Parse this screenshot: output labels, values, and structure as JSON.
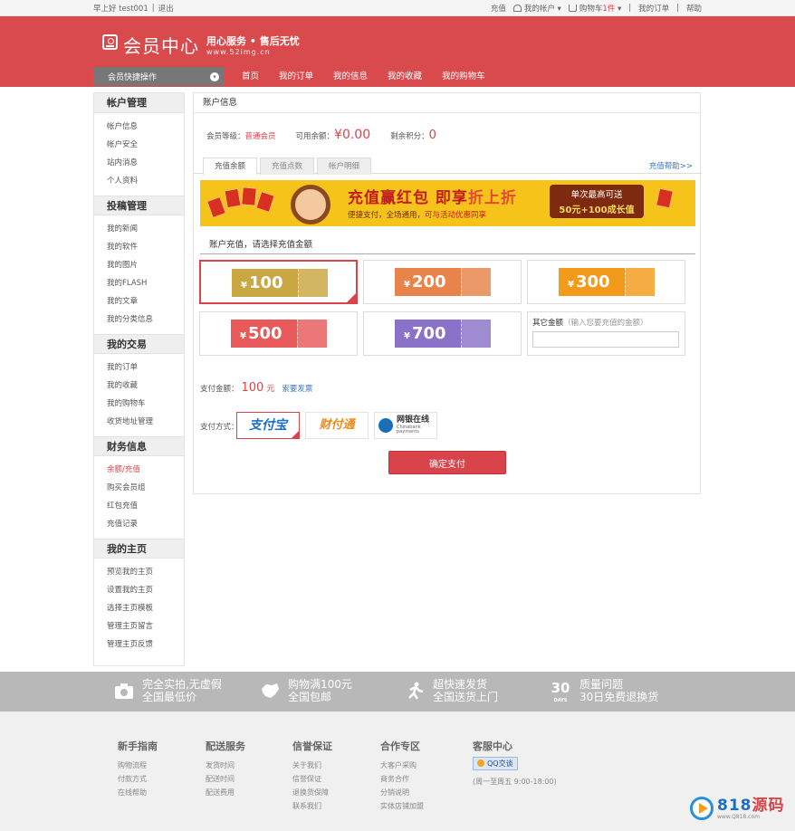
{
  "topbar": {
    "greeting": "早上好 test001",
    "logout": "退出",
    "recharge": "充值",
    "my_account": "我的帐户",
    "cart_label": "购物车",
    "cart_count": "1件",
    "my_orders": "我的订单",
    "help": "帮助"
  },
  "header": {
    "title": "会员中心",
    "slogan": "用心服务 • 售后无忧",
    "url": "www.52img.cn"
  },
  "nav": {
    "quick": "会员快捷操作",
    "links": [
      "首页",
      "我的订单",
      "我的信息",
      "我的收藏",
      "我的购物车"
    ]
  },
  "sidebar": [
    {
      "title": "帐户管理",
      "items": [
        "帐户信息",
        "帐户安全",
        "站内消息",
        "个人资料"
      ]
    },
    {
      "title": "投稿管理",
      "items": [
        "我的新闻",
        "我的软件",
        "我的图片",
        "我的FLASH",
        "我的文章",
        "我的分类信息"
      ]
    },
    {
      "title": "我的交易",
      "items": [
        "我的订单",
        "我的收藏",
        "我的购物车",
        "收货地址管理"
      ]
    },
    {
      "title": "财务信息",
      "items": [
        "余额/充值",
        "购买会员组",
        "红包充值",
        "充值记录"
      ]
    },
    {
      "title": "我的主页",
      "items": [
        "预览我的主页",
        "设置我的主页",
        "选择主页模板",
        "管理主页留言",
        "管理主页反馈"
      ]
    }
  ],
  "account": {
    "header": "账户信息",
    "level_label": "会员等级：",
    "level": "普通会员",
    "balance_label": "可用余额：",
    "balance": "¥0.00",
    "points_label": "剩余积分：",
    "points": "0"
  },
  "tabs": [
    "充值余额",
    "充值点数",
    "帐户明细"
  ],
  "recharge_help": "充值帮助>>",
  "banner": {
    "t1": "充值赢红包",
    "t2": "即享",
    "t3": "折上折",
    "sub1": "便捷支付，全场通用，",
    "sub2": "可与活动优惠同享",
    "box1": "单次最高可送",
    "box2": "50元+100成长值"
  },
  "select_title": "账户充值，请选择充值金额",
  "amounts": [
    "100",
    "200",
    "300",
    "500",
    "700"
  ],
  "currency": "¥",
  "other": {
    "label": "其它金额",
    "hint": "（输入您要充值的金额）",
    "value": ""
  },
  "pay": {
    "label": "支付金额：",
    "amount": "100",
    "unit": "元",
    "invoice": "索要发票"
  },
  "methods": {
    "label": "支付方式：",
    "alipay": "支付宝",
    "tenpay": "财付通",
    "chinabank": "网银在线",
    "chinabank_en": "Chinabank payments"
  },
  "submit": "确定支付",
  "promos": [
    {
      "l1": "完全实拍,无虚假",
      "l2": "全国最低价"
    },
    {
      "l1": "购物满100元",
      "l2": "全国包邮"
    },
    {
      "l1": "超快速发货",
      "l2": "全国送货上门"
    },
    {
      "l1": "质量问题",
      "l2": "30日免费退换货"
    }
  ],
  "days_badge": {
    "num": "30",
    "word": "DAYS"
  },
  "footer": {
    "cols": [
      {
        "title": "新手指南",
        "items": [
          "购物流程",
          "付款方式",
          "在线帮助"
        ]
      },
      {
        "title": "配送服务",
        "items": [
          "发货时间",
          "配送时间",
          "配送费用"
        ]
      },
      {
        "title": "信誉保证",
        "items": [
          "关于我们",
          "信誉保证",
          "退换货保障",
          "联系我们"
        ]
      },
      {
        "title": "合作专区",
        "items": [
          "大客户采购",
          "商务合作",
          "分销说明",
          "实体店铺加盟"
        ]
      }
    ],
    "service_title": "客服中心",
    "qq": "QQ交谈",
    "hours": "(周一至周五 9:00-18:00)"
  },
  "watermark": {
    "brand_a": "818",
    "brand_b": "源码",
    "url": "www.Q818.com"
  },
  "colors": {
    "brand": "#d94a4d",
    "link": "#3a78c4",
    "ticket_100": "#c9a742",
    "ticket_200": "#e8834a",
    "ticket_300": "#f29a1a",
    "ticket_500": "#e85a5a",
    "ticket_700": "#8a72c8"
  }
}
